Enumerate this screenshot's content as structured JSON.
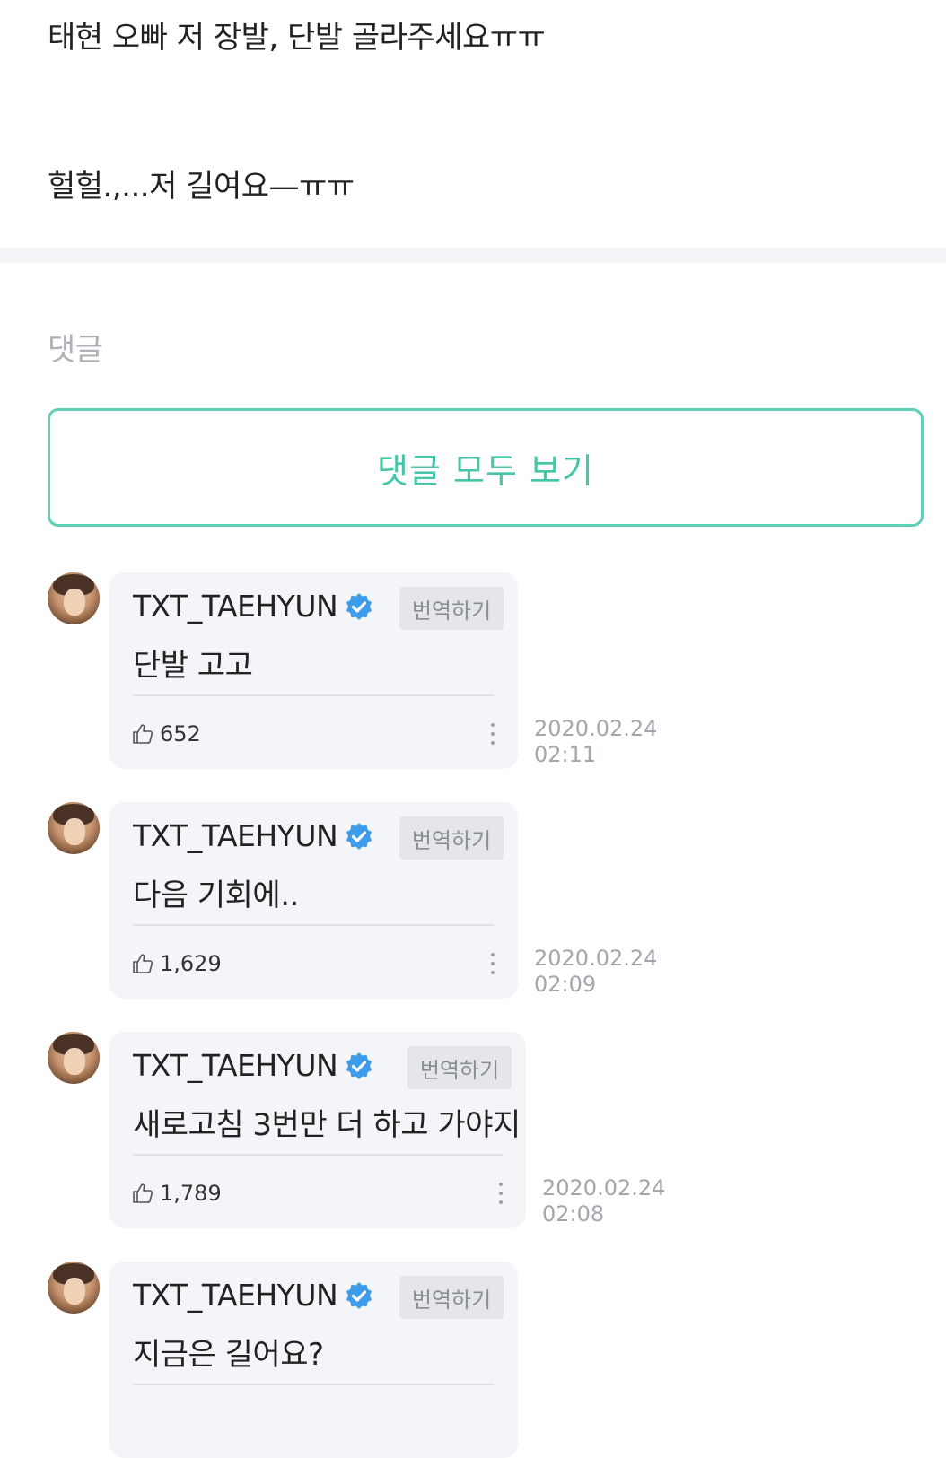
{
  "post": {
    "line1": "태현 오빠 저 장발, 단발 골라주세요ㅠㅠ",
    "line2": "헐헐.,...저 길여요—ㅠㅠ"
  },
  "comments_section": {
    "heading": "댓글",
    "view_all_label": "댓글 모두 보기"
  },
  "comments": [
    {
      "author": "TXT_TAEHYUN",
      "translate_label": "번역하기",
      "text": "단발 고고",
      "likes": "652",
      "date": "2020.02.24",
      "time": "02:11"
    },
    {
      "author": "TXT_TAEHYUN",
      "translate_label": "번역하기",
      "text": "다음 기회에..",
      "likes": "1,629",
      "date": "2020.02.24",
      "time": "02:09"
    },
    {
      "author": "TXT_TAEHYUN",
      "translate_label": "번역하기",
      "text": "새로고침 3번만 더 하고 가야지",
      "likes": "1,789",
      "date": "2020.02.24",
      "time": "02:08"
    },
    {
      "author": "TXT_TAEHYUN",
      "translate_label": "번역하기",
      "text": "지금은 길어요?"
    }
  ],
  "icons": {
    "verified": "verified-badge-icon",
    "like": "thumbs-up-icon",
    "more": "more-vertical-icon"
  },
  "colors": {
    "accent": "#47c5a7",
    "accent_border": "#5ed0b6",
    "verified_blue": "#3d9be9",
    "bubble_bg": "#f3f5f9",
    "muted_text": "#a3a7ad"
  }
}
